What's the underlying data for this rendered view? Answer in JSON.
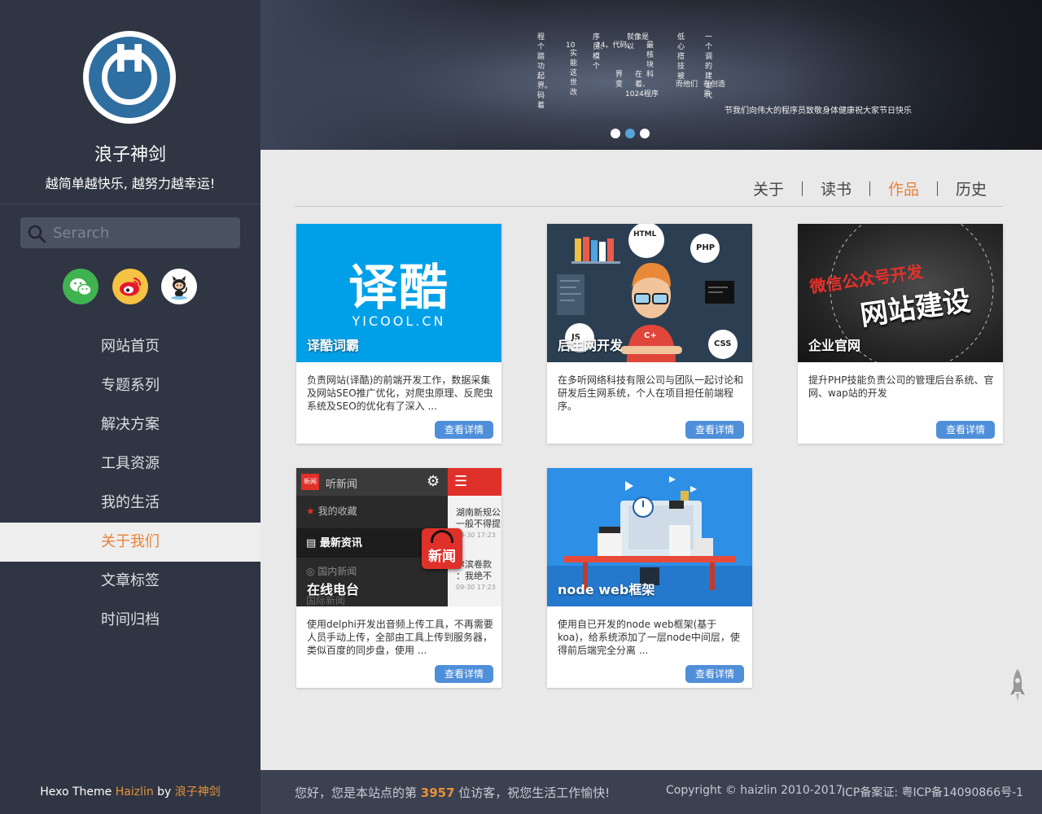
{
  "sidebar": {
    "avatar_letter": "H",
    "site_name": "浪子神剑",
    "slogan": "越简单越快乐, 越努力越幸运!",
    "search": {
      "placeholder": "Serarch",
      "value": ""
    },
    "social": [
      {
        "name": "wechat",
        "color": "#3fb34f"
      },
      {
        "name": "weibo",
        "color": "#f5c244"
      },
      {
        "name": "github",
        "color": "#ffffff"
      }
    ],
    "nav": [
      {
        "label": "网站首页"
      },
      {
        "label": "专题系列"
      },
      {
        "label": "解决方案"
      },
      {
        "label": "工具资源"
      },
      {
        "label": "我的生活"
      },
      {
        "label": "关于我们",
        "active": true
      },
      {
        "label": "文章标签"
      },
      {
        "label": "时间归档"
      }
    ],
    "footer": {
      "prefix": "Hexo Theme ",
      "theme": "Haizlin",
      "by": " by ",
      "author": "浪子神剑"
    }
  },
  "banner": {
    "poem_columns": [
      "程个踏功起界。码着",
      "10",
      "实能这世改",
      "序员、模个",
      "24。代码。",
      "界变",
      "就像是以",
      "在着、",
      "最核块科",
      "1024程序",
      "低心搭技被",
      "而他们",
      "一个调的建世代",
      "在创造员"
    ],
    "caption": "节我们向伟大的程序员致敬身体健康祝大家节日快乐",
    "dots": 3,
    "active_dot": 1
  },
  "tabs": [
    {
      "label": "关于"
    },
    {
      "label": "读书"
    },
    {
      "label": "作品",
      "active": true
    },
    {
      "label": "历史"
    }
  ],
  "cards": [
    {
      "title": "译酷词霸",
      "logo_text": "译酷",
      "logo_sub": "YICOOL.CN",
      "desc": "负责网站(译酷)的前端开发工作，数据采集及网站SEO推广优化，对爬虫原理、反爬虫系统及SEO的优化有了深入 ...",
      "button": "查看详情"
    },
    {
      "title": "后生网开发",
      "badges": [
        "HTML",
        "PHP",
        "CSS",
        "JS",
        "C+"
      ],
      "desc": "在多听网络科技有限公司与团队一起讨论和研发后生网系统，个人在项目担任前端程序。",
      "button": "查看详情"
    },
    {
      "title": "企业官网",
      "overlay_red": "微信公众号开发",
      "overlay_white": "网站建设",
      "desc": "提升PHP技能负责公司的管理后台系统、官网、wap站的开发",
      "button": "查看详情"
    },
    {
      "title": "在线电台",
      "app_brand": "新闻",
      "app_title": "听新闻",
      "app_menu": [
        "我的收藏",
        "最新资讯",
        "国内新闻",
        "国际新闻"
      ],
      "app_side": [
        "湖南新规公",
        "一般不得提",
        "09-30 17:23",
        "尔滨卷款",
        "：我绝不",
        "09-30 17:23"
      ],
      "badge": "新闻",
      "desc": "使用delphi开发出音频上传工具，不再需要人员手动上传，全部由工具上传到服务器，类似百度的同步盘，使用 ...",
      "button": "查看详情"
    },
    {
      "title": "node web框架",
      "desc": "使用自已开发的node web框架(基于koa)，给系统添加了一层node中间层，使得前后端完全分离 ...",
      "button": "查看详情"
    }
  ],
  "footer": {
    "visits_prefix": "您好，您是本站点的第 ",
    "visits_count": "3957",
    "visits_suffix": " 位访客，祝您生活工作愉快!",
    "copyright": "Copyright © haizlin 2010-2017",
    "icp": "ICP备案证: 粤ICP备14090866号-1"
  }
}
